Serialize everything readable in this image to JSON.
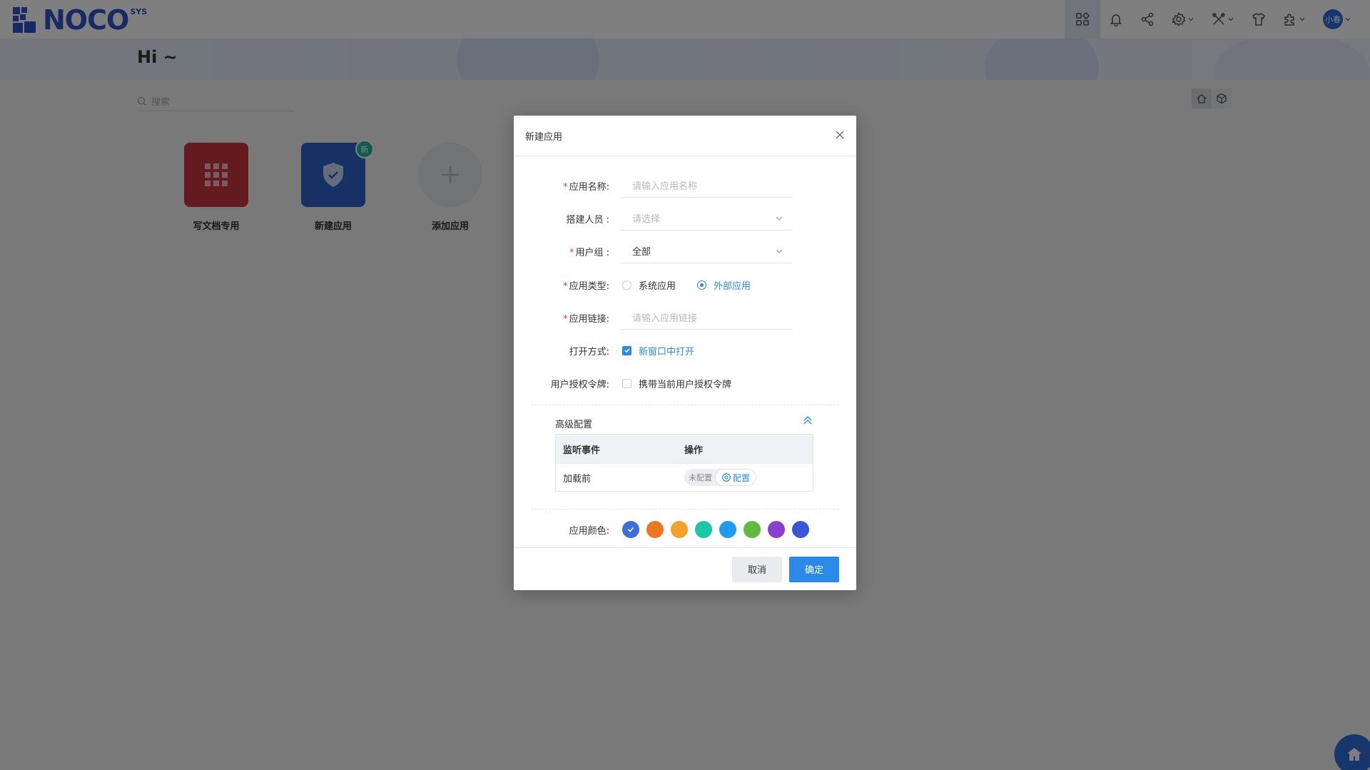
{
  "brand": {
    "name": "NOCO",
    "sup": "SYS"
  },
  "greeting": "Hi ~",
  "header": {
    "icons": [
      "apps-icon",
      "bell-icon",
      "share-icon",
      "gear-icon",
      "tools-icon",
      "shirt-icon",
      "puzzle-icon"
    ],
    "user_initials": "小春"
  },
  "search": {
    "placeholder": "搜索"
  },
  "apps": [
    {
      "label": "写文档专用",
      "color": "#c8353f",
      "icon": "grid-icon"
    },
    {
      "label": "新建应用",
      "color": "#2f62c8",
      "icon": "shield-check-icon",
      "badge": "新"
    }
  ],
  "add_app_label": "添加应用",
  "modal": {
    "title": "新建应用",
    "fields": {
      "name": {
        "label": "应用名称:",
        "placeholder": "请输入应用名称",
        "required": true
      },
      "builder": {
        "label": "搭建人员 :",
        "placeholder": "请选择",
        "required": false
      },
      "group": {
        "label": "用户组 :",
        "value": "全部",
        "required": true
      },
      "type": {
        "label": "应用类型:",
        "options": [
          "系统应用",
          "外部应用"
        ],
        "selected": "外部应用",
        "required": true
      },
      "link": {
        "label": "应用链接:",
        "placeholder": "请输入应用链接",
        "required": true
      },
      "open_mode": {
        "label": "打开方式:",
        "option": "新窗口中打开",
        "checked": true
      },
      "token": {
        "label": "用户授权令牌:",
        "option": "携带当前用户授权令牌",
        "checked": false
      }
    },
    "advanced": {
      "title": "高级配置",
      "columns": [
        "监听事件",
        "操作"
      ],
      "rows": [
        {
          "event": "加载前",
          "status": "未配置",
          "action": "配置"
        }
      ]
    },
    "color": {
      "label": "应用颜色:",
      "swatches": [
        "#3b6fe0",
        "#f07520",
        "#f5a02a",
        "#1cc7a4",
        "#1e9bf0",
        "#5fba3f",
        "#8a3fcf",
        "#3a56d6"
      ],
      "selected_index": 0
    },
    "buttons": {
      "cancel": "取消",
      "ok": "确定"
    }
  }
}
